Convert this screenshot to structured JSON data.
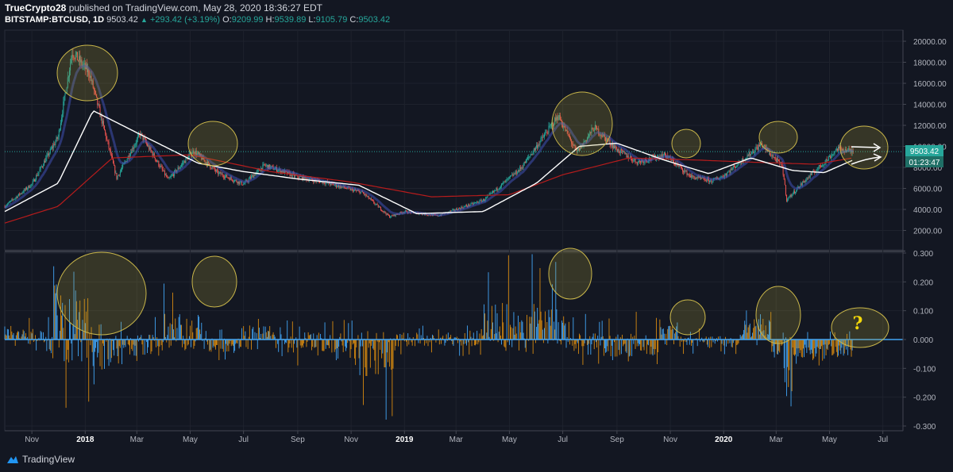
{
  "header": {
    "author": "TrueCrypto28",
    "published_text": "published on TradingView.com, May 28, 2020 18:36:27 EDT",
    "symbol": "BITSTAMP:BTCUSD, 1D",
    "last": "9503.42",
    "change": "+293.42 (+3.19%)",
    "o_label": "O:",
    "o": "9209.99",
    "h_label": "H:",
    "h": "9539.89",
    "l_label": "L:",
    "l": "9105.79",
    "c_label": "C:",
    "c": "9503.42"
  },
  "price_badge": "9503.42",
  "countdown_badge": "01:23:47",
  "annotation_question": "?",
  "brand": "TradingView",
  "colors": {
    "background": "#131722",
    "up": "#26a69a",
    "down": "#ef5350",
    "ma_white": "#ffffff",
    "ma_red": "#b71c1c",
    "hist_blue": "#42a5f5",
    "hist_orange": "#d68910",
    "circle": "#c9b64a"
  },
  "chart_data": [
    {
      "type": "line",
      "title": "",
      "yaxis_ticks": [
        "20000.00",
        "18000.00",
        "16000.00",
        "14000.00",
        "12000.00",
        "10000.00",
        "8000.00",
        "6000.00",
        "4000.00",
        "2000.00"
      ],
      "ylim": [
        0,
        21000
      ],
      "xaxis_ticks": [
        "Nov",
        "2018",
        "Mar",
        "May",
        "Jul",
        "Sep",
        "Nov",
        "2019",
        "Mar",
        "May",
        "Jul",
        "Sep",
        "Nov",
        "2020",
        "Mar",
        "May",
        "Jul"
      ],
      "xlim": [
        "2017-10-01",
        "2020-07-24"
      ],
      "series": [
        {
          "x": [
            "2017-10-01",
            "2017-11-01",
            "2017-12-01",
            "2017-12-17",
            "2018-01-06",
            "2018-02-06",
            "2018-03-05",
            "2018-04-06",
            "2018-05-05",
            "2018-06-01",
            "2018-07-01",
            "2018-07-25",
            "2018-09-01",
            "2018-10-01",
            "2018-11-14",
            "2018-12-15",
            "2019-01-01",
            "2019-02-08",
            "2019-04-02",
            "2019-05-14",
            "2019-06-26",
            "2019-07-17",
            "2019-08-06",
            "2019-09-01",
            "2019-09-24",
            "2019-10-26",
            "2019-11-25",
            "2019-12-18",
            "2020-01-01",
            "2020-02-13",
            "2020-03-08",
            "2020-03-13",
            "2020-04-01",
            "2020-04-29",
            "2020-05-10",
            "2020-05-28"
          ],
          "y": [
            4300,
            6400,
            10900,
            19000,
            16900,
            7000,
            11200,
            6800,
            9600,
            7500,
            6400,
            8200,
            7100,
            6600,
            5600,
            3300,
            3800,
            3400,
            4900,
            7900,
            12900,
            9400,
            11800,
            9700,
            8500,
            9200,
            7100,
            6700,
            7200,
            10200,
            8100,
            4900,
            6600,
            8800,
            9800,
            9503.42
          ]
        },
        {
          "x": [
            "2017-10-01",
            "2017-12-01",
            "2018-01-10",
            "2018-03-01",
            "2018-05-10",
            "2018-07-01",
            "2018-09-01",
            "2018-11-10",
            "2019-01-15",
            "2019-04-01",
            "2019-06-01",
            "2019-07-20",
            "2019-09-01",
            "2019-10-25",
            "2019-12-15",
            "2020-02-01",
            "2020-03-20",
            "2020-04-25",
            "2020-05-28"
          ],
          "y": [
            3800,
            6500,
            13400,
            11300,
            8400,
            7600,
            6900,
            6300,
            3600,
            3800,
            6500,
            10000,
            10300,
            8700,
            7400,
            8900,
            7700,
            7500,
            8700
          ]
        },
        {
          "x": [
            "2017-10-01",
            "2017-12-01",
            "2018-02-01",
            "2018-05-01",
            "2018-08-01",
            "2018-11-01",
            "2019-02-01",
            "2019-05-01",
            "2019-07-01",
            "2019-09-15",
            "2019-12-01",
            "2020-02-01",
            "2020-04-15",
            "2020-05-28"
          ],
          "y": [
            2700,
            4300,
            8900,
            9200,
            7600,
            6600,
            5200,
            5400,
            7300,
            8900,
            8700,
            8500,
            8300,
            8900
          ]
        }
      ]
    },
    {
      "type": "bar",
      "title": "",
      "yaxis_ticks": [
        "0.300",
        "0.200",
        "0.100",
        "0.000",
        "-0.100",
        "-0.200",
        "-0.300"
      ],
      "ylim": [
        -0.31,
        0.31
      ],
      "seed": 7,
      "segments": [
        [
          "2017-10-01",
          "2017-10-25",
          0.02,
          0.05,
          -0.03
        ],
        [
          "2017-10-25",
          "2017-11-25",
          0.01,
          0.09,
          -0.05
        ],
        [
          "2017-11-25",
          "2018-01-10",
          0.05,
          0.3,
          -0.3
        ],
        [
          "2018-01-10",
          "2018-02-15",
          -0.04,
          0.08,
          -0.16
        ],
        [
          "2018-02-15",
          "2018-04-01",
          -0.02,
          0.08,
          -0.09
        ],
        [
          "2018-04-01",
          "2018-05-15",
          0.03,
          0.22,
          -0.05
        ],
        [
          "2018-05-15",
          "2018-07-01",
          -0.02,
          0.04,
          -0.08
        ],
        [
          "2018-07-01",
          "2018-08-01",
          0.02,
          0.09,
          -0.04
        ],
        [
          "2018-08-01",
          "2018-11-10",
          -0.01,
          0.07,
          -0.09
        ],
        [
          "2018-11-10",
          "2018-12-20",
          -0.06,
          0.03,
          -0.28
        ],
        [
          "2018-12-20",
          "2019-04-01",
          0.0,
          0.05,
          -0.06
        ],
        [
          "2019-04-01",
          "2019-07-05",
          0.05,
          0.3,
          -0.06
        ],
        [
          "2019-07-05",
          "2019-10-20",
          -0.02,
          0.1,
          -0.09
        ],
        [
          "2019-10-20",
          "2019-11-10",
          0.03,
          0.07,
          -0.02
        ],
        [
          "2019-11-10",
          "2020-01-20",
          -0.01,
          0.04,
          -0.06
        ],
        [
          "2020-01-20",
          "2020-02-25",
          0.04,
          0.12,
          -0.03
        ],
        [
          "2020-02-25",
          "2020-03-10",
          -0.03,
          0.03,
          -0.07
        ],
        [
          "2020-03-10",
          "2020-03-20",
          -0.15,
          0.01,
          -0.3
        ],
        [
          "2020-03-20",
          "2020-05-28",
          -0.04,
          0.03,
          -0.09
        ]
      ]
    }
  ]
}
